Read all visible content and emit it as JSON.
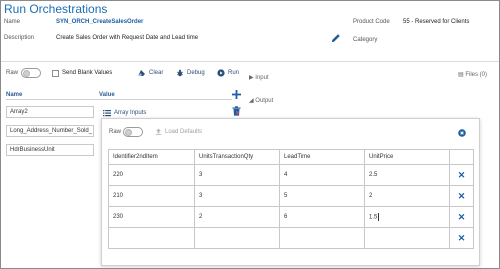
{
  "header": {
    "page_title": "Run Orchestrations",
    "name_label": "Name",
    "name_value": "SYN_ORCH_CreateSalesOrder",
    "description_label": "Description",
    "description_value": "Create Sales Order with Request Date and Lead time",
    "product_code_label": "Product Code",
    "product_code_value": "55 - Reserved for Clients",
    "category_label": "Category"
  },
  "toolbar": {
    "raw_label": "Raw",
    "send_blank_label": "Send Blank Values",
    "clear_label": "Clear",
    "debug_label": "Debug",
    "run_label": "Run",
    "input_label": "Input",
    "output_label": "Output",
    "files_label": "Files (0)"
  },
  "left_panel": {
    "name_header": "Name",
    "value_header": "Value",
    "names": [
      "Array2",
      "Long_Address_Number_Sold_",
      "HdrBusinessUnit"
    ],
    "array_inputs_label": "Array Inputs"
  },
  "modal": {
    "raw_label": "Raw",
    "load_defaults_label": "Load Defaults",
    "columns": [
      "Identifier2ndItem",
      "UnitsTransactionQty",
      "LeadTime",
      "UnitPrice"
    ],
    "rows": [
      [
        "220",
        "3",
        "4",
        "2.5"
      ],
      [
        "210",
        "3",
        "5",
        "2"
      ],
      [
        "230",
        "2",
        "6",
        "1.5"
      ],
      [
        "",
        "",
        "",
        ""
      ]
    ]
  },
  "colors": {
    "accent_blue": "#1a6fb5",
    "link_blue": "#2c4e77",
    "delete_blue": "#1d5ea6"
  },
  "icons": [
    "pencil-icon",
    "eraser-icon",
    "bug-icon",
    "play-icon",
    "plus-icon",
    "trash-icon",
    "list-icon",
    "close-circle-icon",
    "delete-row-icon"
  ]
}
